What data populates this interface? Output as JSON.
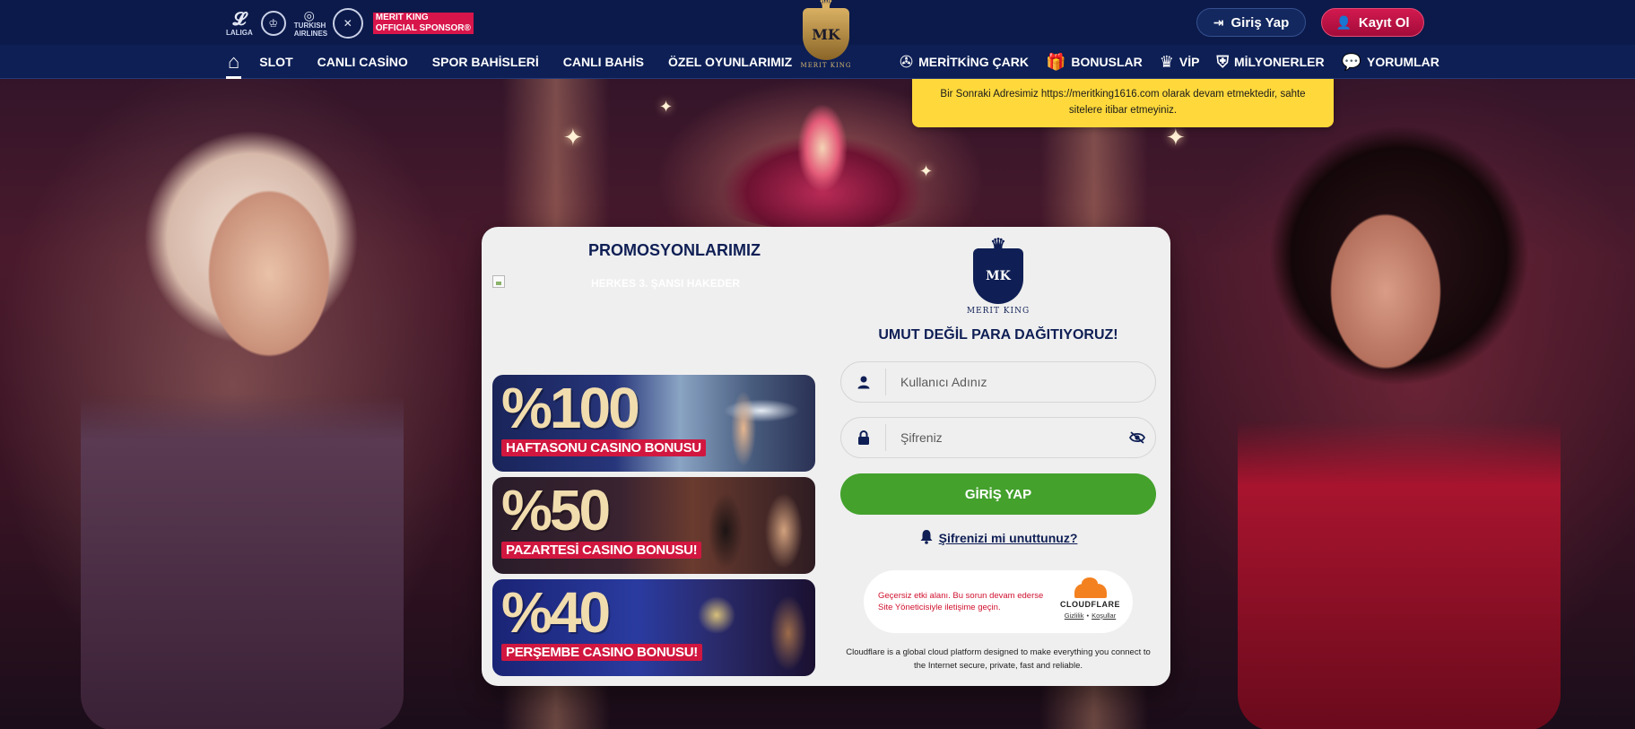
{
  "header": {
    "sponsors": {
      "laliga": "LALIGA",
      "airline": "TURKISH AIRLINES",
      "tag_line1": "MERIT KING",
      "tag_line2": "OFFICIAL SPONSOR®"
    },
    "brand_name": "MERIT KING",
    "brand_monogram": "MK",
    "login_label": "Giriş Yap",
    "register_label": "Kayıt Ol"
  },
  "nav": {
    "left": [
      "SLOT",
      "CANLI CASİNO",
      "SPOR BAHİSLERİ",
      "CANLI BAHİS",
      "ÖZEL OYUNLARIMIZ"
    ],
    "right": [
      {
        "icon": "wheel-icon",
        "glyph": "✇",
        "label": "MERİTKİNG ÇARK"
      },
      {
        "icon": "gift-icon",
        "glyph": "🎁",
        "label": "BONUSLAR"
      },
      {
        "icon": "crown-icon",
        "glyph": "♛",
        "label": "VİP"
      },
      {
        "icon": "shield-icon",
        "glyph": "⛨",
        "label": "MİLYONERLER"
      },
      {
        "icon": "chat-icon",
        "glyph": "💬",
        "label": "YORUMLAR"
      }
    ]
  },
  "announcement": "Bir Sonraki Adresimiz https://meritking1616.com olarak devam etmektedir, sahte sitelere itibar etmeyiniz.",
  "promo": {
    "title": "PROMOSYONLARIMIZ",
    "broken_image_alt": "HERKES 3. ŞANSI HAKEDER",
    "banners": [
      {
        "percent": "%100",
        "label": "HAFTASONU CASINO BONUSU"
      },
      {
        "percent": "%50",
        "label": "PAZARTESİ CASINO BONUSU!"
      },
      {
        "percent": "%40",
        "label": "PERŞEMBE CASINO BONUSU!"
      }
    ]
  },
  "login": {
    "brand_name": "MERIT KING",
    "monogram": "MK",
    "slogan": "UMUT DEĞİL PARA DAĞITIYORUZ!",
    "username_placeholder": "Kullanıcı Adınız",
    "password_placeholder": "Şifreniz",
    "submit_label": "GİRİŞ YAP",
    "forgot_label": "Şifrenizi mi unuttunuz?"
  },
  "turnstile": {
    "error": "Geçersiz etki alanı. Bu sorun devam ederse Site Yöneticisiyle iletişime geçin.",
    "brand": "CLOUDFLARE",
    "privacy": "Gizlilik",
    "separator": "•",
    "terms": "Koşullar"
  },
  "cloudflare_desc": "Cloudflare is a global cloud platform designed to make everything you connect to the Internet secure, private, fast and reliable.",
  "colors": {
    "header_bg": "#0b1a4a",
    "announcement_bg": "#ffd93b",
    "submit_green": "#43a12c",
    "register_red": "#d2194f",
    "navy": "#0f1f55"
  }
}
